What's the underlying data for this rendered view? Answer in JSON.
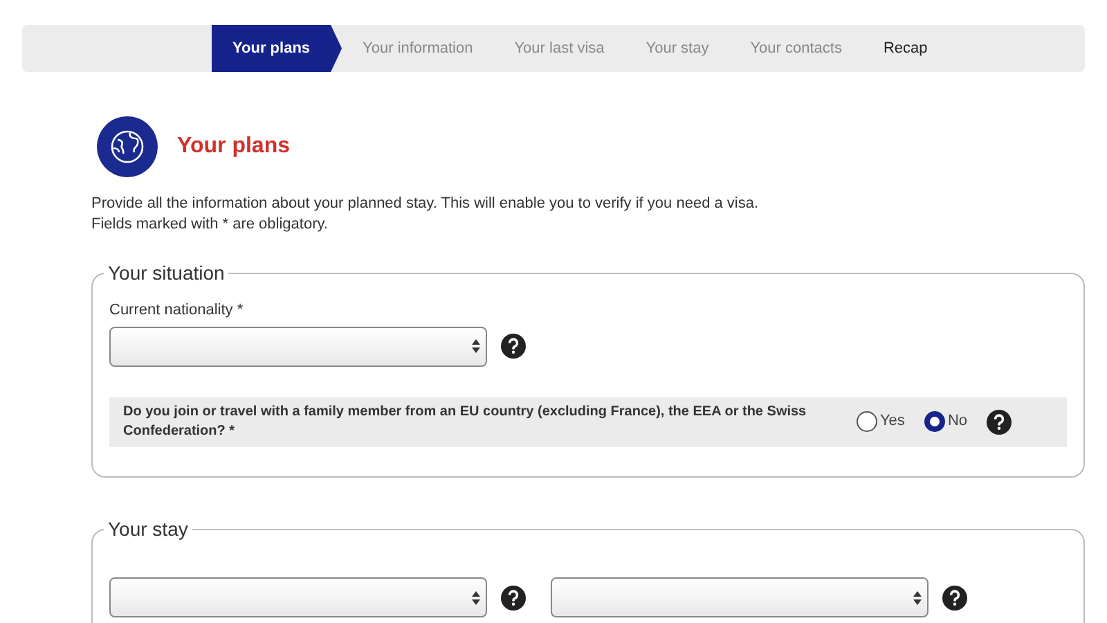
{
  "steps": [
    {
      "label": "Your plans",
      "selected": true
    },
    {
      "label": "Your information",
      "selected": false
    },
    {
      "label": "Your last visa",
      "selected": false
    },
    {
      "label": "Your stay",
      "selected": false
    },
    {
      "label": "Your contacts",
      "selected": false
    },
    {
      "label": "Recap",
      "selected": false
    }
  ],
  "page": {
    "title": "Your plans",
    "intro": "Provide all the information about your planned stay. This will enable you to verify if you need a visa.",
    "note": "Fields marked with * are obligatory."
  },
  "situation": {
    "legend": "Your situation",
    "nationality_label": "Current nationality *",
    "question": "Do you join or travel with a family member from an EU country (excluding France), the EEA or the Swiss Confederation? *",
    "options": [
      {
        "label": "Yes",
        "selected": false
      },
      {
        "label": "No",
        "selected": true
      }
    ]
  },
  "stay": {
    "legend": "Your stay",
    "fields": [
      {
        "kind": "select"
      },
      {
        "kind": "select"
      }
    ]
  }
}
